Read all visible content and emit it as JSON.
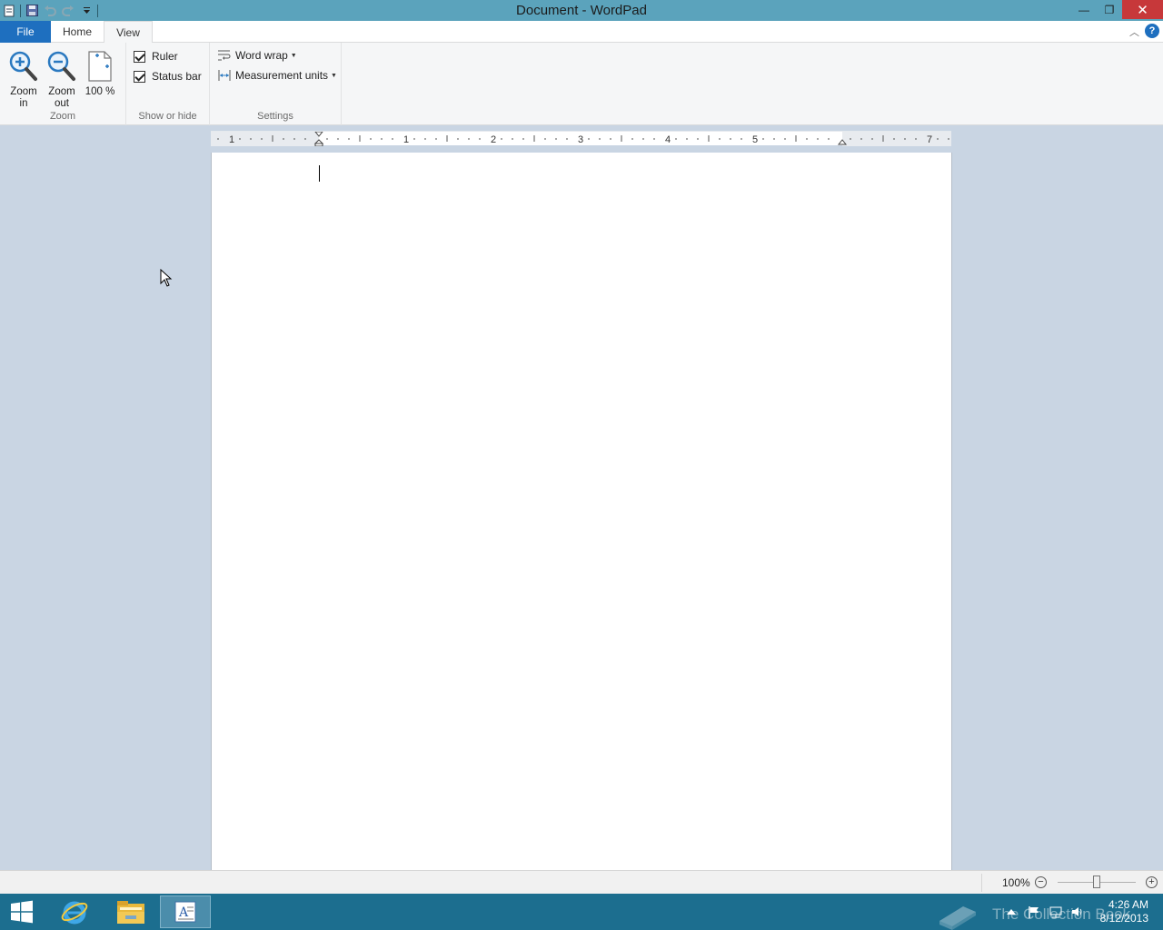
{
  "window": {
    "title": "Document - WordPad",
    "minimize_glyph": "—",
    "restore_glyph": "❐",
    "close_glyph": "✕"
  },
  "tabs": {
    "file": "File",
    "home": "Home",
    "view": "View",
    "collapse_glyph": "︿",
    "help_glyph": "?"
  },
  "ribbon": {
    "zoom_group": {
      "label": "Zoom",
      "zoom_in": "Zoom in",
      "zoom_out": "Zoom out",
      "hundred": "100 %"
    },
    "show_hide_group": {
      "label": "Show or hide",
      "ruler": "Ruler",
      "ruler_checked": true,
      "status_bar": "Status bar",
      "status_bar_checked": true
    },
    "settings_group": {
      "label": "Settings",
      "word_wrap": "Word wrap",
      "measurement_units": "Measurement units"
    }
  },
  "ruler": {
    "numbers": [
      "1",
      "1",
      "2",
      "3",
      "4",
      "5",
      "7"
    ]
  },
  "statusbar": {
    "zoom": "100%",
    "zoom_out_glyph": "−",
    "zoom_in_glyph": "+"
  },
  "taskbar": {
    "watermark": "The Collection Book",
    "time": "4:26 AM",
    "date": "8/12/2013"
  },
  "colors": {
    "titlebar": "#5ba3bc",
    "file_tab": "#1e6fbf",
    "close_button": "#c7383a",
    "workspace": "#c9d5e3",
    "taskbar": "#1c6e8f"
  }
}
